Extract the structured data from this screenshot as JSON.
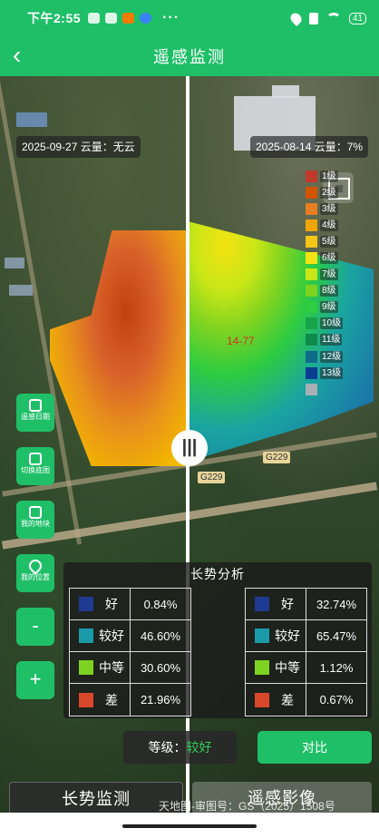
{
  "status": {
    "time": "下午2:55",
    "dots": "···",
    "battery": "41"
  },
  "nav": {
    "title": "遥感监测",
    "back": "‹"
  },
  "map": {
    "left_date": "2025-09-27 云量：无云",
    "right_date": "2025-08-14 云量：7%",
    "field_label": "14-77",
    "road_label": "G229",
    "legend": [
      {
        "label": "1级",
        "color": "#c0392b"
      },
      {
        "label": "2级",
        "color": "#d35400"
      },
      {
        "label": "3级",
        "color": "#e67e22"
      },
      {
        "label": "4级",
        "color": "#f0a500"
      },
      {
        "label": "5级",
        "color": "#f5c518"
      },
      {
        "label": "6级",
        "color": "#f4e312"
      },
      {
        "label": "7级",
        "color": "#c8e617"
      },
      {
        "label": "8级",
        "color": "#7ed321"
      },
      {
        "label": "9级",
        "color": "#2ecc40"
      },
      {
        "label": "10级",
        "color": "#16a34a"
      },
      {
        "label": "11级",
        "color": "#0f8a4a"
      },
      {
        "label": "12级",
        "color": "#0e6b8a"
      },
      {
        "label": "13级",
        "color": "#0b3d91"
      },
      {
        "label": "",
        "color": "#a9b0b5"
      }
    ],
    "side_buttons": [
      {
        "label": "遥感日期",
        "icon": "calendar-icon"
      },
      {
        "label": "切换底图",
        "icon": "layers-icon"
      },
      {
        "label": "我的地块",
        "icon": "field-icon"
      },
      {
        "label": "我的位置",
        "icon": "location-icon"
      }
    ],
    "zoom_out": "-",
    "zoom_in": "+",
    "handle": "|||"
  },
  "analysis": {
    "title": "长势分析",
    "left": [
      {
        "name": "好",
        "value": "0.84%",
        "color": "#1f3a93"
      },
      {
        "name": "较好",
        "value": "46.60%",
        "color": "#1b9aaa"
      },
      {
        "name": "中等",
        "value": "30.60%",
        "color": "#7ed321"
      },
      {
        "name": "差",
        "value": "21.96%",
        "color": "#d9472b"
      }
    ],
    "right": [
      {
        "name": "好",
        "value": "32.74%",
        "color": "#1f3a93"
      },
      {
        "name": "较好",
        "value": "65.47%",
        "color": "#1b9aaa"
      },
      {
        "name": "中等",
        "value": "1.12%",
        "color": "#7ed321"
      },
      {
        "name": "差",
        "value": "0.67%",
        "color": "#d9472b"
      }
    ]
  },
  "grade": {
    "label": "等级：",
    "value": "较好"
  },
  "compare_button": "对比",
  "tabs": {
    "growth": "长势监测",
    "imagery": "遥感影像"
  },
  "copyright": "天地图-审图号：GS（2025）1508号"
}
